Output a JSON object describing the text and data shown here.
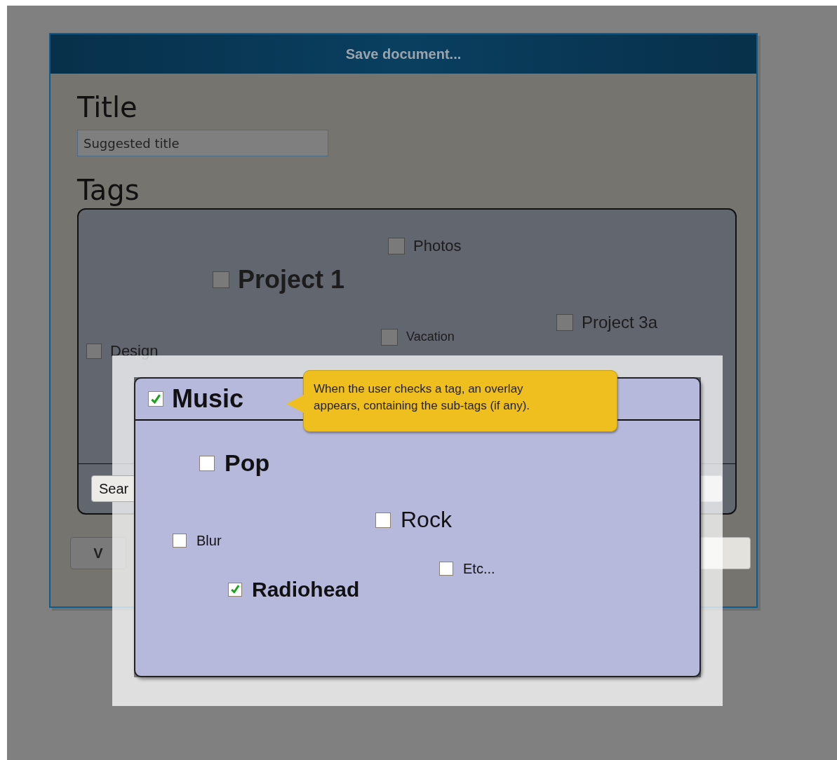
{
  "dialog": {
    "title": "Save document...",
    "title_label": "Title",
    "title_field": {
      "value": "Suggested title"
    },
    "tags_label": "Tags",
    "tags": [
      {
        "label": "Photos",
        "checked": false
      },
      {
        "label": "Project 1",
        "checked": false
      },
      {
        "label": "Project 3a",
        "checked": false
      },
      {
        "label": "Vacation",
        "checked": false
      },
      {
        "label": "Design",
        "checked": false
      }
    ],
    "tag_search": {
      "value": "Sear"
    },
    "v_button": "V"
  },
  "overlay": {
    "tag": {
      "label": "Music",
      "checked": true
    },
    "subtags": [
      {
        "label": "Pop",
        "checked": false
      },
      {
        "label": "Rock",
        "checked": false
      },
      {
        "label": "Blur",
        "checked": false
      },
      {
        "label": "Etc...",
        "checked": false
      },
      {
        "label": "Radiohead",
        "checked": true
      }
    ]
  },
  "tooltip": {
    "text": "When the user checks a tag, an overlay appears, containing the sub-tags (if any)."
  }
}
